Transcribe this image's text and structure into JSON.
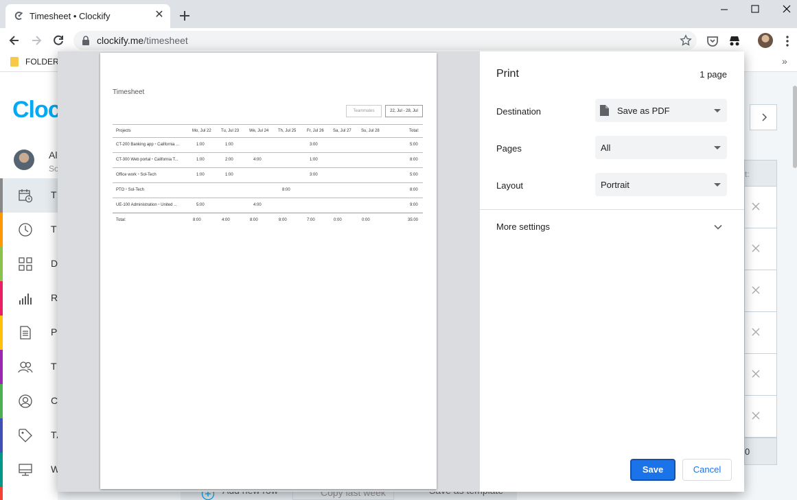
{
  "browser": {
    "tab_title": "Timesheet • Clockify",
    "tab_close_glyph": "✕",
    "url_host": "clockify.me",
    "url_path": "/timesheet",
    "bookmark_folder": "FOLDER",
    "bookmarks_more": "»"
  },
  "app": {
    "logo_text": "Cloc",
    "user_name": "Al",
    "user_sub": "So",
    "nav": [
      {
        "label": "TI",
        "icon": "calendar-clock-icon",
        "color": "#888888"
      },
      {
        "label": "TI",
        "icon": "clock-icon",
        "color": "#ff9800"
      },
      {
        "label": "DA",
        "icon": "dashboard-grid-icon",
        "color": "#8bc34a"
      },
      {
        "label": "RE",
        "icon": "bar-chart-icon",
        "color": "#e91e63"
      },
      {
        "label": "PF",
        "icon": "document-icon",
        "color": "#ffc107"
      },
      {
        "label": "TE",
        "icon": "team-icon",
        "color": "#9c27b0"
      },
      {
        "label": "CL",
        "icon": "client-icon",
        "color": "#4caf50"
      },
      {
        "label": "TA",
        "icon": "tag-icon",
        "color": "#3f51b5"
      },
      {
        "label": "W",
        "icon": "monitor-icon",
        "color": "#009688"
      }
    ],
    "right_header_fragment": "t:",
    "right_total_fragment": "0",
    "bottom_buttons": [
      "Add new row",
      "Copy last week",
      "Save as template"
    ]
  },
  "print_preview": {
    "title": "Timesheet",
    "teammates_placeholder": "Teammates",
    "date_range": "22, Jul - 28, Jul",
    "columns": [
      "Projects",
      "Mo, Jul 22",
      "Tu, Jul 23",
      "We, Jul 24",
      "Th, Jul 25",
      "Fr, Jul 26",
      "Sa, Jul 27",
      "Su, Jul 28",
      "Total:"
    ],
    "rows": [
      {
        "project": "CT-200 Banking app",
        "client": "California ...",
        "cells": [
          "1:00",
          "1:00",
          "",
          "",
          "3:00",
          "",
          ""
        ],
        "total": "5:00"
      },
      {
        "project": "CT-300 Web portal",
        "client": "California T...",
        "cells": [
          "1:00",
          "2:00",
          "4:00",
          "",
          "1:00",
          "",
          ""
        ],
        "total": "8:00"
      },
      {
        "project": "Office work",
        "client": "Sol-Tech",
        "cells": [
          "1:00",
          "1:00",
          "",
          "",
          "3:00",
          "",
          ""
        ],
        "total": "5:00"
      },
      {
        "project": "PTO",
        "client": "Sol-Tech",
        "cells": [
          "",
          "",
          "",
          "8:00",
          "",
          "",
          ""
        ],
        "total": "8:00"
      },
      {
        "project": "UE-100 Administration",
        "client": "United ...",
        "cells": [
          "5:00",
          "",
          "4:00",
          "",
          "",
          "",
          ""
        ],
        "total": "9:00"
      }
    ],
    "totals_label": "Total:",
    "totals": [
      "8:00",
      "4:00",
      "8:00",
      "8:00",
      "7:00",
      "0:00",
      "0:00"
    ],
    "grand_total": "35:00"
  },
  "print_dialog": {
    "title": "Print",
    "page_count": "1 page",
    "destination_label": "Destination",
    "destination_value": "Save as PDF",
    "pages_label": "Pages",
    "pages_value": "All",
    "layout_label": "Layout",
    "layout_value": "Portrait",
    "more_settings": "More settings",
    "save_label": "Save",
    "cancel_label": "Cancel",
    "accent_color": "#1a73e8"
  }
}
